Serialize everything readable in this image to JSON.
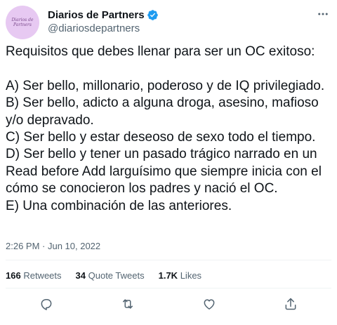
{
  "author": {
    "display_name": "Diarios de Partners",
    "handle": "@diariosdepartners",
    "avatar_text": "Diarios de Partners",
    "verified_icon": "verified-badge-icon"
  },
  "tweet": {
    "lines": [
      "Requisitos que debes llenar para ser un OC exitoso:",
      "",
      "A) Ser bello, millonario, poderoso y de IQ privilegiado.",
      "B) Ser bello, adicto a alguna droga, asesino, mafioso y/o depravado.",
      "C) Ser bello y estar deseoso de sexo todo el tiempo.",
      "D) Ser bello y tener un pasado trágico narrado en un Read before Add larguísimo que siempre inicia con el cómo se conocieron los padres y nació el OC.",
      "E) Una combinación de las anteriores."
    ]
  },
  "timestamp": "2:26 PM · Jun 10, 2022",
  "stats": {
    "retweets_count": "166",
    "retweets_label": "Retweets",
    "quotes_count": "34",
    "quotes_label": "Quote Tweets",
    "likes_count": "1.7K",
    "likes_label": "Likes"
  },
  "actions": [
    "reply-icon",
    "retweet-icon",
    "like-icon",
    "share-icon"
  ],
  "colors": {
    "text": "#0f1419",
    "secondary": "#536471",
    "verified": "#1d9bf0",
    "divider": "#eff3f4"
  }
}
